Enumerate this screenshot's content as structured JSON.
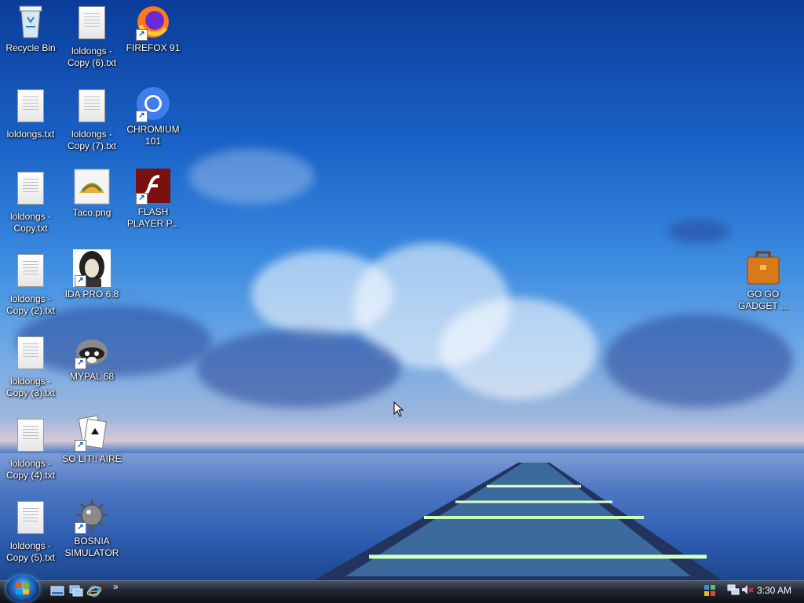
{
  "desktop": {
    "icons": [
      {
        "label": "Recycle Bin"
      },
      {
        "label": "loldongs - Copy (6).txt"
      },
      {
        "label": "FIREFOX 91"
      },
      {
        "label": "loldongs.txt"
      },
      {
        "label": "loldongs - Copy (7).txt"
      },
      {
        "label": "CHROMIUM 101"
      },
      {
        "label": "loldongs - Copy.txt"
      },
      {
        "label": "Taco.png"
      },
      {
        "label": "FLASH PLAYER P..."
      },
      {
        "label": "loldongs - Copy (2).txt"
      },
      {
        "label": "IDA PRO 6.8"
      },
      {
        "label": "loldongs - Copy (3).txt"
      },
      {
        "label": "MYPAL 68"
      },
      {
        "label": "loldongs - Copy (4).txt"
      },
      {
        "label": "SO LIT!! AIRE"
      },
      {
        "label": "loldongs - Copy (5).txt"
      },
      {
        "label": "BOSNIA SIMULATOR"
      },
      {
        "label": "GO GO GADGET ..."
      }
    ]
  },
  "taskbar": {
    "start_label": "Start",
    "quick_launch_overflow": "»",
    "clock": "3:30 AM"
  },
  "icons": {
    "start": "windows-orb-icon",
    "show_desktop": "show-desktop-icon",
    "switch_windows": "switch-windows-icon",
    "ie": "internet-explorer-icon",
    "network": "network-icon",
    "volume": "volume-muted-icon",
    "tray": "tray-app-icon"
  },
  "colors": {
    "taskbar": "#1a1e27",
    "text": "#ffffff"
  }
}
